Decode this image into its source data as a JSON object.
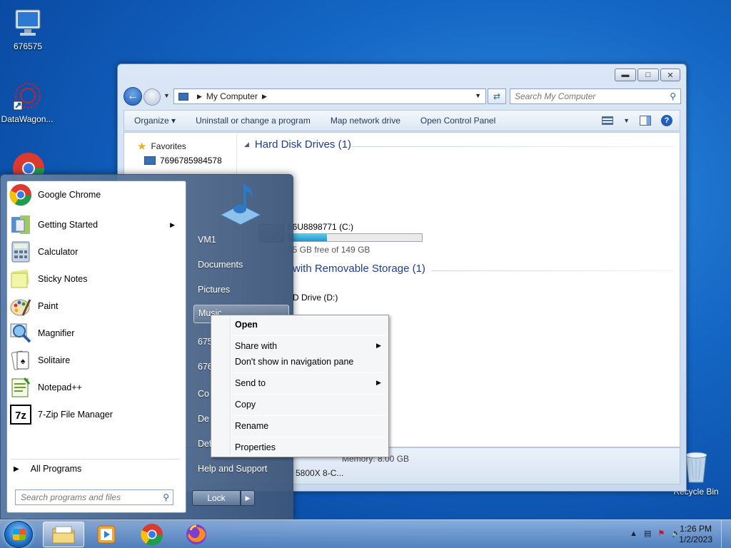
{
  "desktop": {
    "icons": [
      {
        "label": "676575",
        "icon": "computer-icon"
      },
      {
        "label": "DataWagon...",
        "icon": "datawagon-icon"
      },
      {
        "label": "Recycle Bin",
        "icon": "recycle-bin-icon"
      }
    ]
  },
  "explorer": {
    "address": {
      "location": "My Computer"
    },
    "search_placeholder": "Search My Computer",
    "toolbar": {
      "organize": "Organize",
      "uninstall": "Uninstall or change a program",
      "map_drive": "Map network drive",
      "control_panel": "Open Control Panel"
    },
    "nav": {
      "favorites": "Favorites",
      "item1": "7696785984578"
    },
    "groups": {
      "hdd": "Hard Disk Drives (1)",
      "removable": "with Removable Storage (1)"
    },
    "drive_c": {
      "name": "56U8898771 (C:)",
      "free_text": "05 GB free of 149 GB",
      "used_fraction": 0.29
    },
    "drive_d": {
      "name": "D Drive (D:)"
    },
    "details": {
      "memory": "Memory: 8.00 GB",
      "cpu": "5800X 8-C..."
    }
  },
  "start_menu": {
    "programs": [
      {
        "label": "Google Chrome",
        "icon": "chrome-icon",
        "has_submenu": false
      },
      {
        "label": "Getting Started",
        "icon": "getting-started-icon",
        "has_submenu": true
      },
      {
        "label": "Calculator",
        "icon": "calculator-icon",
        "has_submenu": false
      },
      {
        "label": "Sticky Notes",
        "icon": "sticky-notes-icon",
        "has_submenu": false
      },
      {
        "label": "Paint",
        "icon": "paint-icon",
        "has_submenu": false
      },
      {
        "label": "Magnifier",
        "icon": "magnifier-icon",
        "has_submenu": false
      },
      {
        "label": "Solitaire",
        "icon": "solitaire-icon",
        "has_submenu": false
      },
      {
        "label": "Notepad++",
        "icon": "notepadpp-icon",
        "has_submenu": false
      },
      {
        "label": "7-Zip File Manager",
        "icon": "7zip-icon",
        "has_submenu": false
      }
    ],
    "all_programs": "All Programs",
    "search_placeholder": "Search programs and files",
    "right": {
      "vm1": "VM1",
      "documents": "Documents",
      "pictures": "Pictures",
      "music": "Music",
      "item675": "675",
      "item676": "676",
      "item_co": "Co",
      "item_de": "De",
      "item_def": "Def",
      "help": "Help and Support",
      "lock": "Lock"
    }
  },
  "context_menu": {
    "items": {
      "open": "Open",
      "share_with": "Share with",
      "dont_show": "Don't show in navigation pane",
      "send_to": "Send to",
      "copy": "Copy",
      "rename": "Rename",
      "properties": "Properties"
    }
  },
  "taskbar": {
    "clock_time": "1:26 PM",
    "clock_date": "1/2/2023"
  }
}
